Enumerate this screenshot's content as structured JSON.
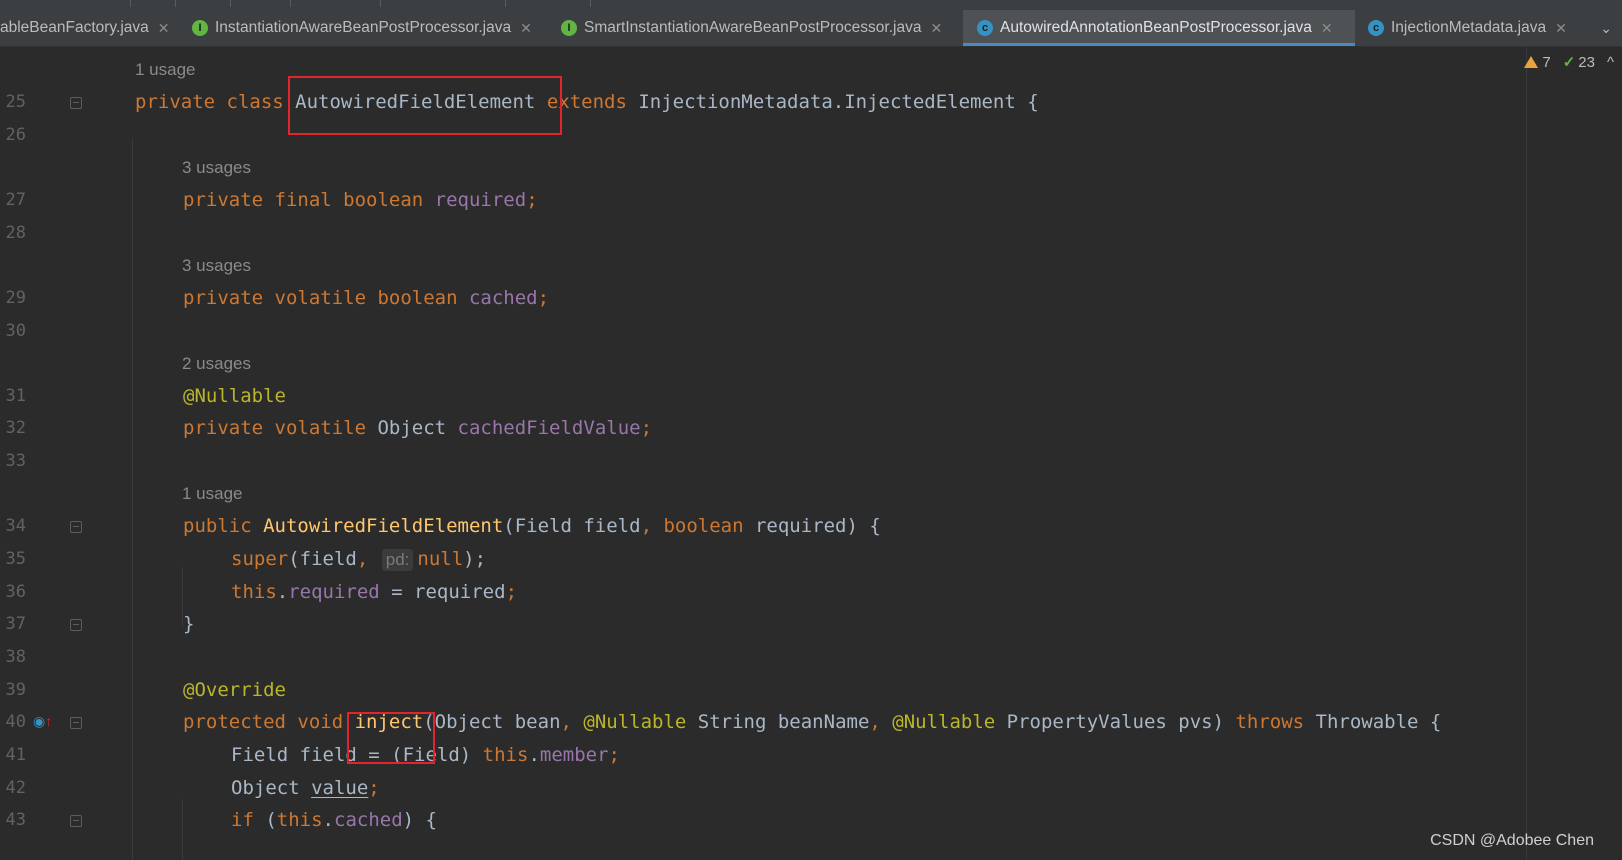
{
  "tabs": [
    {
      "label": "ableBeanFactory.java",
      "icon": "none",
      "close": "✕",
      "active": false
    },
    {
      "label": "InstantiationAwareBeanPostProcessor.java",
      "icon": "interface-icon",
      "icon_letter": "I",
      "close": "✕",
      "active": false
    },
    {
      "label": "SmartInstantiationAwareBeanPostProcessor.java",
      "icon": "interface-icon",
      "icon_letter": "I",
      "close": "✕",
      "active": false
    },
    {
      "label": "AutowiredAnnotationBeanPostProcessor.java",
      "icon": "class-icon",
      "icon_letter": "c",
      "close": "✕",
      "active": true
    },
    {
      "label": "InjectionMetadata.java",
      "icon": "class-icon",
      "icon_letter": "c",
      "close": "✕",
      "active": false
    }
  ],
  "tab_overflow": "⌄",
  "inspection": {
    "warnings": "7",
    "checks": "23",
    "collapse": "^"
  },
  "gutter": {
    "lines": [
      "25",
      "26",
      "27",
      "28",
      "29",
      "30",
      "31",
      "32",
      "33",
      "34",
      "35",
      "36",
      "37",
      "38",
      "39",
      "40",
      "41",
      "42",
      "43"
    ]
  },
  "usages": {
    "class": "1 usage",
    "required": "3 usages",
    "cached": "3 usages",
    "cachedFieldValue": "2 usages",
    "constructor": "1 usage"
  },
  "code": {
    "l25": {
      "kw1": "private class ",
      "name": "AutowiredFieldElement",
      "kw2": " extends ",
      "rest": "InjectionMetadata.InjectedElement {"
    },
    "l27": {
      "kw": "private final boolean ",
      "fld": "required",
      "end": ";"
    },
    "l29": {
      "kw": "private volatile boolean ",
      "fld": "cached",
      "end": ";"
    },
    "l31": {
      "ann": "@Nullable"
    },
    "l32": {
      "kw": "private volatile ",
      "type": "Object ",
      "fld": "cachedFieldValue",
      "end": ";"
    },
    "l34": {
      "kw": "public ",
      "name": "AutowiredFieldElement",
      "p1": "(Field field",
      "comma": ", ",
      "kw2": "boolean ",
      "p2": "required) {"
    },
    "l35": {
      "kw": "super",
      "p1": "(field",
      "comma": ",",
      "hint": "pd:",
      "kw2": "null",
      "end": ");"
    },
    "l36": {
      "kw": "this",
      "dot": ".",
      "fld": "required",
      "p": " = required",
      "end": ";"
    },
    "l37": {
      "brace": "}"
    },
    "l39": {
      "ann": "@Override"
    },
    "l40": {
      "kw": "protected void ",
      "name": "inject",
      "p1": "(Object bean",
      "c1": ", ",
      "ann1": "@Nullable ",
      "p2": "String beanName",
      "c2": ", ",
      "ann2": "@Nullable ",
      "p3": "PropertyValues pvs) ",
      "kw2": "throws ",
      "rest": "Throwable {"
    },
    "l41": {
      "p1": "Field field = (Field) ",
      "kw": "this",
      "dot": ".",
      "fld": "member",
      "end": ";"
    },
    "l42": {
      "type": "Object ",
      "var": "value",
      "end": ";"
    },
    "l43": {
      "kw": "if ",
      "p1": "(",
      "kw2": "this",
      "dot": ".",
      "fld": "cached",
      "end": ") {"
    }
  },
  "watermark": "CSDN @Adobee Chen",
  "colors": {
    "background": "#2b2b2b",
    "keyword": "#cc7832",
    "field": "#9876aa",
    "annotation": "#bbb529",
    "method": "#ffc66d",
    "text": "#a9b7c6",
    "highlight_box": "#e0262c",
    "active_tab_underline": "#4a88c7"
  }
}
